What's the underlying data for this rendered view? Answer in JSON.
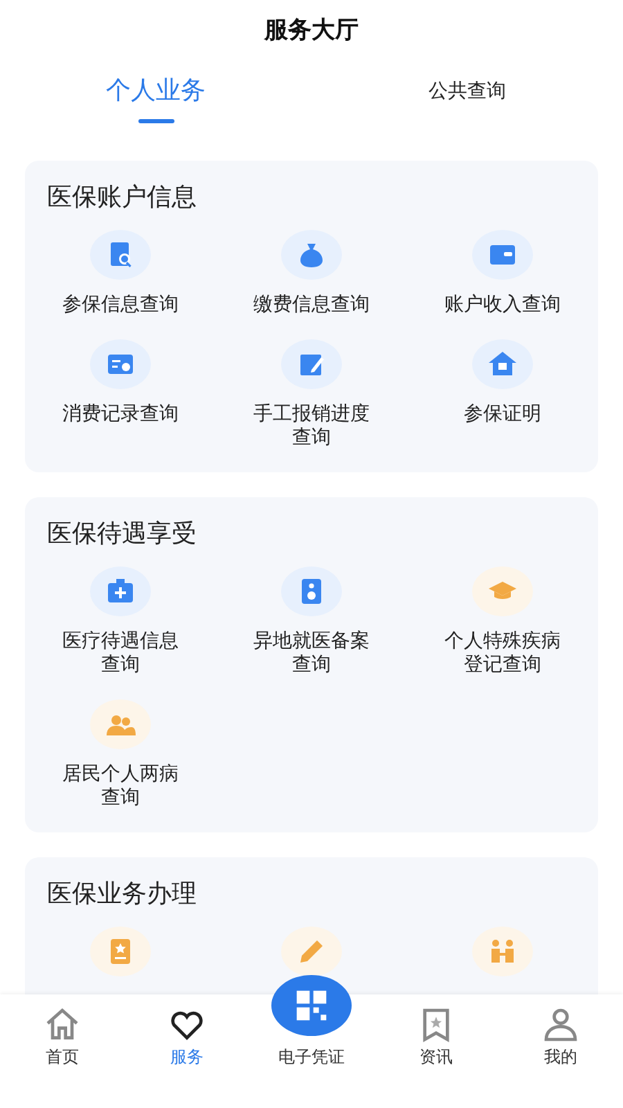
{
  "header": {
    "title": "服务大厅"
  },
  "tabs": [
    {
      "label": "个人业务",
      "selected": true
    },
    {
      "label": "公共查询",
      "selected": false
    }
  ],
  "sections": [
    {
      "title": "医保账户信息",
      "items": [
        {
          "label": "参保信息查询",
          "color": "#3a86f0"
        },
        {
          "label": "缴费信息查询",
          "color": "#3a86f0"
        },
        {
          "label": "账户收入查询",
          "color": "#3a86f0"
        },
        {
          "label": "消费记录查询",
          "color": "#3a86f0"
        },
        {
          "label": "手工报销进度查询",
          "color": "#3a86f0"
        },
        {
          "label": "参保证明",
          "color": "#3a86f0"
        }
      ]
    },
    {
      "title": "医保待遇享受",
      "items": [
        {
          "label": "医疗待遇信息查询",
          "color": "#3a86f0"
        },
        {
          "label": "异地就医备案查询",
          "color": "#3a86f0"
        },
        {
          "label": "个人特殊疾病登记查询",
          "color": "#f2a944"
        },
        {
          "label": "居民个人两病查询",
          "color": "#f2a944"
        }
      ]
    },
    {
      "title": "医保业务办理",
      "items": [
        {
          "color": "#f2a944"
        },
        {
          "color": "#f2a944"
        },
        {
          "color": "#f2a944"
        }
      ]
    }
  ],
  "nav": [
    {
      "label": "首页",
      "kind": "tab",
      "selected": false
    },
    {
      "label": "服务",
      "kind": "tab",
      "selected": true
    },
    {
      "label": "电子凭证",
      "kind": "scan",
      "selected": false
    },
    {
      "label": "资讯",
      "kind": "tab",
      "selected": false
    },
    {
      "label": "我的",
      "kind": "tab",
      "selected": false
    }
  ]
}
